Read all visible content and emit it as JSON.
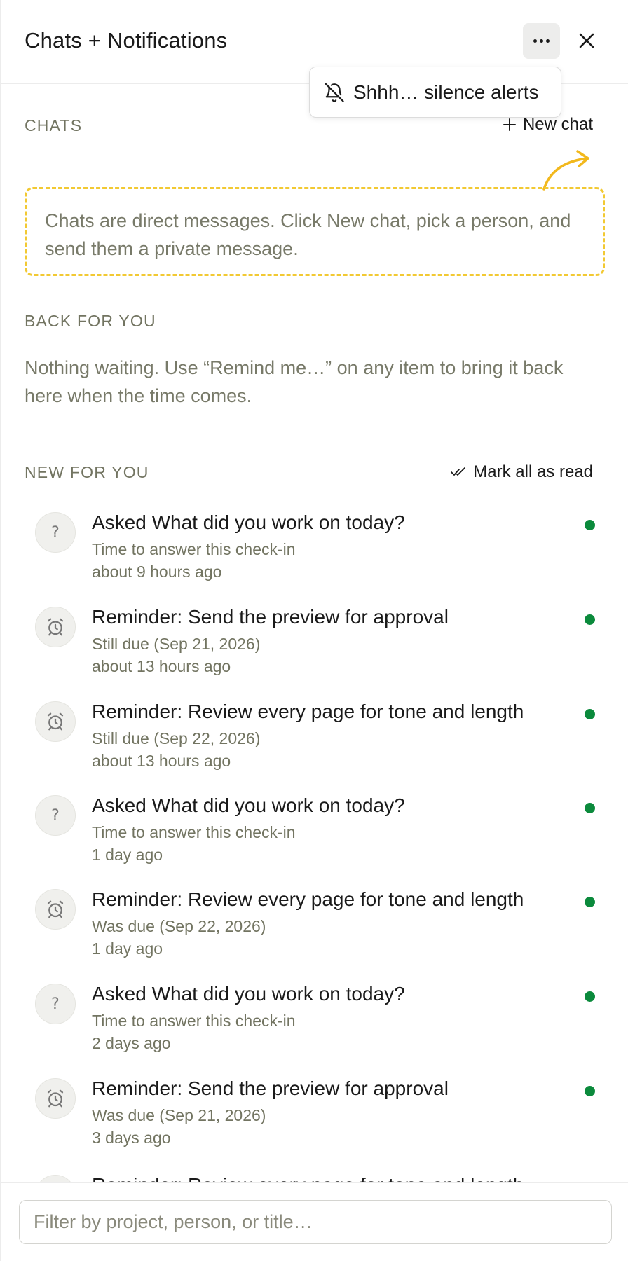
{
  "header": {
    "title": "Chats + Notifications",
    "more_icon": "more-horizontal-icon",
    "close_icon": "close-icon"
  },
  "popover": {
    "label": "Shhh… silence alerts",
    "icon": "bell-off-icon"
  },
  "chats": {
    "label": "CHATS",
    "new_chat_label": "New chat",
    "hint": "Chats are direct messages. Click New chat, pick a person, and send them a private message.",
    "hint_border_color": "#f2c933"
  },
  "back_for_you": {
    "label": "BACK FOR YOU",
    "empty_text": "Nothing waiting. Use “Remind me…” on any item to bring it back here when the time comes."
  },
  "new_for_you": {
    "label": "NEW FOR YOU",
    "mark_all_label": "Mark all as read",
    "unread_color": "#0b8a3c",
    "items": [
      {
        "icon": "question-icon",
        "prefix": "Asked ",
        "title": "What did you work on today?",
        "sub": "Time to answer this check-in",
        "time": "about 9 hours ago"
      },
      {
        "icon": "alarm-clock-icon",
        "prefix": "Reminder: ",
        "title": "Send the preview for approval",
        "sub": "Still due (Sep 21, 2026)",
        "time": "about 13 hours ago"
      },
      {
        "icon": "alarm-clock-icon",
        "prefix": "Reminder: ",
        "title": "Review every page for tone and length",
        "sub": "Still due (Sep 22, 2026)",
        "time": "about 13 hours ago"
      },
      {
        "icon": "question-icon",
        "prefix": "Asked ",
        "title": "What did you work on today?",
        "sub": "Time to answer this check-in",
        "time": "1 day ago"
      },
      {
        "icon": "alarm-clock-icon",
        "prefix": "Reminder: ",
        "title": "Review every page for tone and length",
        "sub": "Was due (Sep 22, 2026)",
        "time": "1 day ago"
      },
      {
        "icon": "question-icon",
        "prefix": "Asked ",
        "title": "What did you work on today?",
        "sub": "Time to answer this check-in",
        "time": "2 days ago"
      },
      {
        "icon": "alarm-clock-icon",
        "prefix": "Reminder: ",
        "title": "Send the preview for approval",
        "sub": "Was due (Sep 21, 2026)",
        "time": "3 days ago"
      },
      {
        "icon": "alarm-clock-icon",
        "prefix": "Reminder: ",
        "title": "Review every page for tone and length",
        "sub": "",
        "time": ""
      }
    ]
  },
  "filter": {
    "placeholder": "Filter by project, person, or title…"
  }
}
